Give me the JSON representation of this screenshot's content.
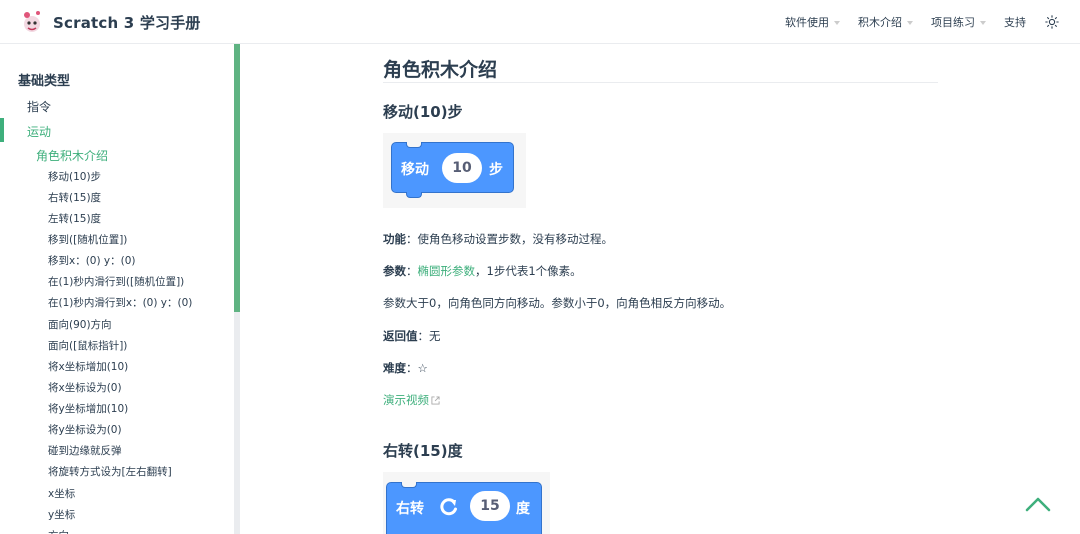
{
  "navbar": {
    "title": "Scratch 3 学习手册",
    "items": [
      {
        "label": "软件使用",
        "dropdown": true
      },
      {
        "label": "积木介绍",
        "dropdown": true
      },
      {
        "label": "项目练习",
        "dropdown": true
      },
      {
        "label": "支持",
        "dropdown": false
      }
    ],
    "theme_icon": "sun-icon"
  },
  "sidebar": {
    "heading": "基础类型",
    "links": [
      "指令",
      "运动"
    ],
    "active_link": "运动",
    "group": "角色积木介绍",
    "items": [
      "移动(10)步",
      "右转(15)度",
      "左转(15)度",
      "移到([随机位置])",
      "移到x：(0) y：(0)",
      "在(1)秒内滑行到([随机位置])",
      "在(1)秒内滑行到x：(0) y：(0)",
      "面向(90)方向",
      "面向([鼠标指针])",
      "将x坐标增加(10)",
      "将x坐标设为(0)",
      "将y坐标增加(10)",
      "将y坐标设为(0)",
      "碰到边缘就反弹",
      "将旋转方式设为[左右翻转]",
      "x坐标",
      "y坐标",
      "方向"
    ]
  },
  "content": {
    "page_title": "角色积木介绍",
    "section1": {
      "heading": "移动(10)步",
      "block": {
        "label": "移动",
        "value": "10",
        "suffix": "步"
      },
      "func_label": "功能",
      "func_text": "：使角色移动设置步数，没有移动过程。",
      "param_label": "参数",
      "param_sep": "：",
      "param_link": "椭圆形参数",
      "param_text": "，1步代表1个像素。",
      "note": "参数大于0，向角色同方向移动。参数小于0，向角色相反方向移动。",
      "return_label": "返回值",
      "return_text": "：无",
      "difficulty_label": "难度",
      "difficulty_text": "：☆",
      "video_link": "演示视频"
    },
    "section2": {
      "heading": "右转(15)度",
      "block": {
        "label": "右转",
        "value": "15",
        "suffix": "度",
        "icon": "rotate-right-icon"
      }
    }
  },
  "colors": {
    "accent": "#3eaf7c",
    "block_blue": "#4c97ff",
    "text": "#2c3e50"
  }
}
